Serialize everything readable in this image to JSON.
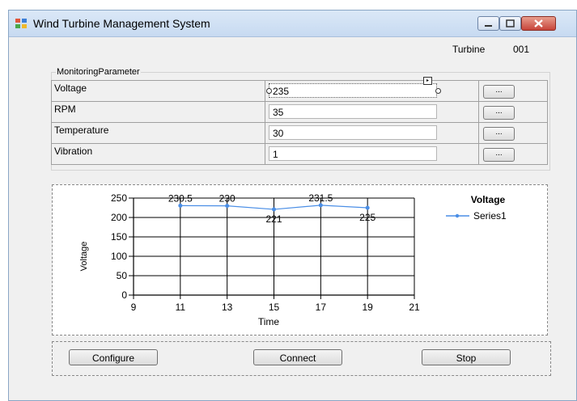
{
  "window": {
    "title": "Wind Turbine  Management System"
  },
  "header": {
    "turbine_label": "Turbine",
    "turbine_id": "001"
  },
  "monitoring": {
    "group_title": "MonitoringParameter",
    "rows": [
      {
        "name": "Voltage",
        "value": "235",
        "button": "..."
      },
      {
        "name": "RPM",
        "value": "35",
        "button": "..."
      },
      {
        "name": "Temperature",
        "value": "30",
        "button": "..."
      },
      {
        "name": "Vibration",
        "value": "1",
        "button": "..."
      }
    ]
  },
  "chart_data": {
    "type": "line",
    "title": "Voltage",
    "xlabel": "Time",
    "ylabel": "Voltage",
    "xlim": [
      9,
      21
    ],
    "ylim": [
      0,
      250
    ],
    "xticks": [
      9,
      11,
      13,
      15,
      17,
      19,
      21
    ],
    "yticks": [
      0,
      50,
      100,
      150,
      200,
      250
    ],
    "grid": true,
    "legend_position": "top-right",
    "series": [
      {
        "name": "Series1",
        "color": "#4a8ee6",
        "x": [
          11,
          13,
          15,
          17,
          19
        ],
        "y": [
          230.5,
          230,
          221,
          231.5,
          225
        ],
        "labels": [
          "230.5",
          "230",
          "221",
          "231.5",
          "225"
        ]
      }
    ]
  },
  "controls": {
    "configure": "Configure",
    "connect": "Connect",
    "stop": "Stop"
  }
}
